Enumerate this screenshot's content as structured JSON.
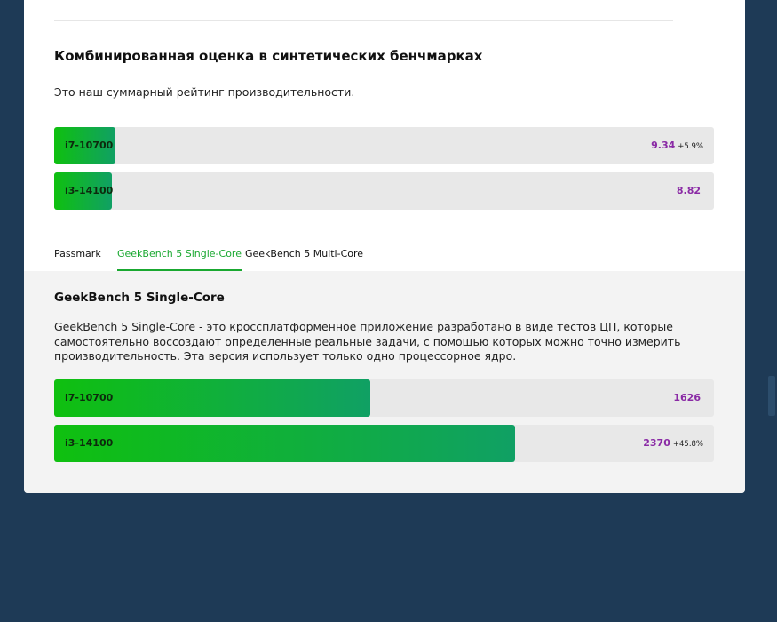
{
  "combined": {
    "title": "Комбинированная оценка в синтетических бенчмарках",
    "description": "Это наш суммарный рейтинг производительности.",
    "bars": [
      {
        "label": "i7-10700",
        "value": "9.34",
        "pct": "+5.9%",
        "fill_fraction": 0.093
      },
      {
        "label": "i3-14100",
        "value": "8.82",
        "pct": "",
        "fill_fraction": 0.087
      }
    ]
  },
  "tabs": [
    {
      "label": "Passmark",
      "active": false
    },
    {
      "label": "GeekBench 5 Single-Core",
      "active": true
    },
    {
      "label": "GeekBench 5 Multi-Core",
      "active": false
    }
  ],
  "panel": {
    "title": "GeekBench 5 Single-Core",
    "description": "GeekBench 5 Single-Core - это кроссплатформенное приложение разработано в виде тестов ЦП, которые самостоятельно воссоздают определенные реальные задачи, с помощью которых можно точно измерить производительность. Эта версия использует только одно процессорное ядро.",
    "bars": [
      {
        "label": "i7-10700",
        "value": "1626",
        "pct": "",
        "fill_fraction": 0.48
      },
      {
        "label": "i3-14100",
        "value": "2370",
        "pct": "+45.8%",
        "fill_fraction": 0.698
      }
    ]
  },
  "colors": {
    "page_bg": "#1e3a56",
    "bar_gradient_start": "#0fc00f",
    "bar_gradient_end": "#10a064",
    "bar_track": "#e8e8e8",
    "score_value": "#8a2aa5",
    "tab_active": "#19a830"
  }
}
